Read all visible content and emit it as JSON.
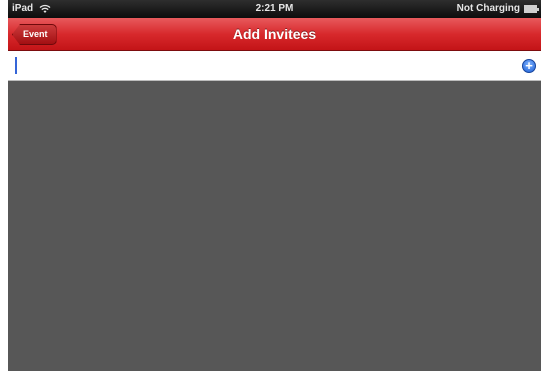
{
  "status_bar": {
    "device": "iPad",
    "time": "2:21 PM",
    "battery_text": "Not Charging",
    "icons": [
      "wifi-icon",
      "battery-icon"
    ]
  },
  "nav_bar": {
    "back_label": "Event",
    "title": "Add Invitees",
    "color": "#d8292c"
  },
  "invitee_input": {
    "value": "",
    "placeholder": ""
  },
  "add_button": {
    "icon": "plus-circle-icon",
    "glyph": "+"
  }
}
